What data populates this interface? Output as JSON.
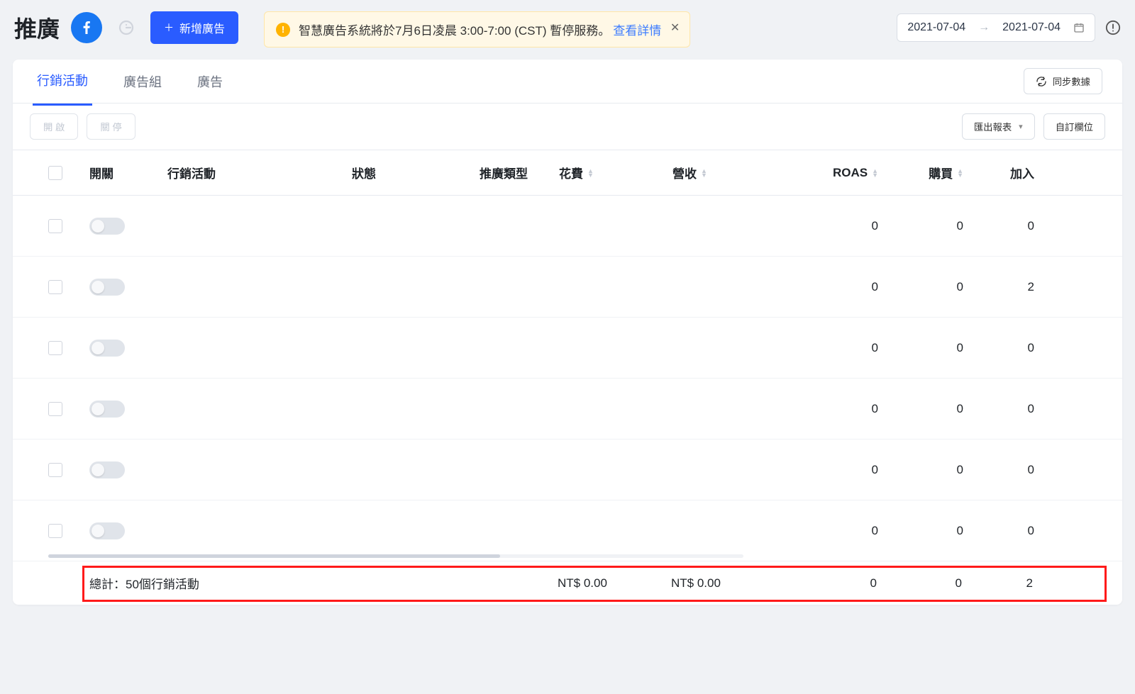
{
  "header": {
    "title": "推廣",
    "add_button": "新增廣告",
    "date_start": "2021-07-04",
    "date_end": "2021-07-04"
  },
  "banner": {
    "text": "智慧廣告系統將於7月6日凌晨 3:00-7:00 (CST) 暫停服務。",
    "link_label": "查看詳情"
  },
  "tabs": {
    "campaign": "行銷活動",
    "adgroup": "廣告組",
    "ad": "廣告",
    "sync": "同步數據"
  },
  "toolbar": {
    "open": "開 啟",
    "close": "關 停",
    "export": "匯出報表",
    "columns": "自訂欄位"
  },
  "columns": {
    "switch": "開關",
    "campaign": "行銷活動",
    "status": "狀態",
    "type": "推廣類型",
    "spend": "花費",
    "revenue": "營收",
    "roas": "ROAS",
    "purchases": "購買",
    "cart": "加入"
  },
  "rows": [
    {
      "roas": "0",
      "purchases": "0",
      "cart": "0"
    },
    {
      "roas": "0",
      "purchases": "0",
      "cart": "2"
    },
    {
      "roas": "0",
      "purchases": "0",
      "cart": "0"
    },
    {
      "roas": "0",
      "purchases": "0",
      "cart": "0"
    },
    {
      "roas": "0",
      "purchases": "0",
      "cart": "0"
    },
    {
      "roas": "0",
      "purchases": "0",
      "cart": "0"
    }
  ],
  "footer": {
    "total_label": "總計：50個行銷活動",
    "spend": "NT$ 0.00",
    "revenue": "NT$ 0.00",
    "roas": "0",
    "purchases": "0",
    "cart": "2"
  }
}
